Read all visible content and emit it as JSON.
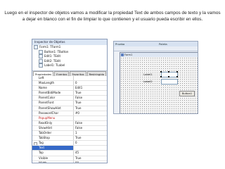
{
  "caption": "Luego en el inspector de objetos vamos a modificar la propiedad Text de ambos campos de texto y la vamos a dejar en blanco con el fin de limpiar lo que contienen y el usuario pueda escribir en ellos.",
  "inspector": {
    "title": "Inspector de Objetos",
    "tree": [
      {
        "label": "Form1: TForm1",
        "indent": 0
      },
      {
        "label": "Button1: TButton",
        "indent": 1
      },
      {
        "label": "Edit1: TEdit",
        "indent": 1
      },
      {
        "label": "Edit2: TEdit",
        "indent": 1
      },
      {
        "label": "Label1: TLabel",
        "indent": 1
      },
      {
        "label": "Label2: TLabel",
        "indent": 1
      }
    ],
    "tabs": [
      "Propiedades",
      "Eventos",
      "Favoritos",
      "Restringido"
    ],
    "properties": [
      {
        "name": "Left",
        "value": "",
        "kind": "normal"
      },
      {
        "name": "MaxLength",
        "value": "0",
        "kind": "normal"
      },
      {
        "name": "Name",
        "value": "Edit1",
        "kind": "normal"
      },
      {
        "name": "ParentBidiMode",
        "value": "True",
        "kind": "normal"
      },
      {
        "name": "ParentColor",
        "value": "False",
        "kind": "normal"
      },
      {
        "name": "ParentFont",
        "value": "True",
        "kind": "normal"
      },
      {
        "name": "ParentShowHint",
        "value": "True",
        "kind": "normal"
      },
      {
        "name": "PasswordChar",
        "value": "#0",
        "kind": "normal"
      },
      {
        "name": "PopupMenu",
        "value": "",
        "kind": "special"
      },
      {
        "name": "ReadOnly",
        "value": "False",
        "kind": "normal"
      },
      {
        "name": "ShowHint",
        "value": "False",
        "kind": "normal"
      },
      {
        "name": "TabOrder",
        "value": "1",
        "kind": "normal"
      },
      {
        "name": "TabStop",
        "value": "True",
        "kind": "normal"
      },
      {
        "name": "Tag",
        "value": "0",
        "kind": "expand"
      },
      {
        "name": "Text",
        "value": "",
        "kind": "selected"
      },
      {
        "name": "Top",
        "value": "45",
        "kind": "normal"
      },
      {
        "name": "Visible",
        "value": "True",
        "kind": "normal"
      },
      {
        "name": "Width",
        "value": "80",
        "kind": "normal"
      }
    ]
  },
  "form_window": {
    "top_left": "Prueba",
    "top_right": "Paleta",
    "form_title": "Form1",
    "label1": "Label1",
    "label2": "Label2",
    "button": "Button1"
  }
}
